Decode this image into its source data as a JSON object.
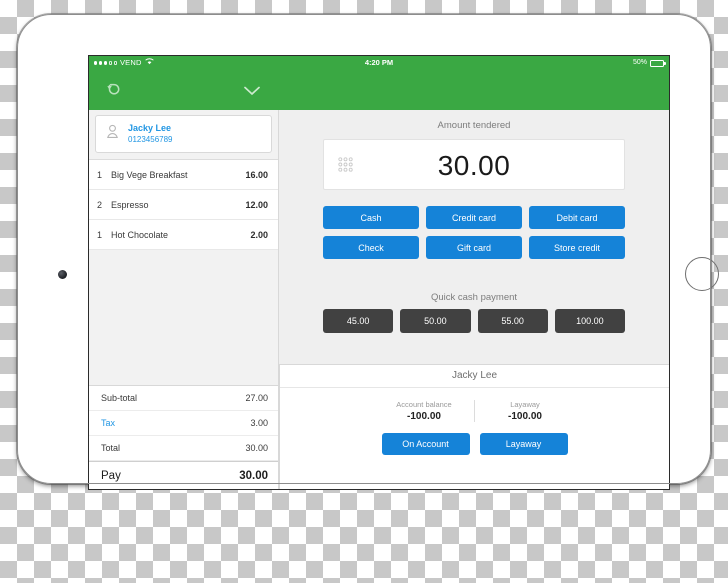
{
  "device": {
    "name": "tablet-device",
    "camera": "front-camera",
    "home_button": "home-button"
  },
  "status_bar": {
    "carrier": "VEND",
    "signal_filled": 3,
    "signal_total": 5,
    "wifi_icon": "wifi-icon",
    "time": "4:20 PM",
    "battery_percent": "50%",
    "battery_level": 50
  },
  "nav_bar": {
    "back_icon": "back-arrow-icon",
    "chevron_icon": "chevron-down-icon",
    "color": "#3aa843"
  },
  "sale": {
    "customer": {
      "name": "Jacky Lee",
      "phone": "0123456789",
      "icon": "person-icon"
    },
    "line_items": [
      {
        "qty": "1",
        "name": "Big Vege Breakfast",
        "price": "16.00"
      },
      {
        "qty": "2",
        "name": "Espresso",
        "price": "12.00"
      },
      {
        "qty": "1",
        "name": "Hot Chocolate",
        "price": "2.00"
      }
    ],
    "totals": [
      {
        "label": "Sub-total",
        "value": "27.00"
      },
      {
        "label": "Tax",
        "value": "3.00"
      },
      {
        "label": "Total",
        "value": "30.00"
      }
    ],
    "pay": {
      "label": "Pay",
      "value": "30.00"
    }
  },
  "payment": {
    "amount_label": "Amount tendered",
    "amount_value": "30.00",
    "keypad_icon": "keypad-grid-icon",
    "methods": [
      "Cash",
      "Credit card",
      "Debit card",
      "Check",
      "Gift card",
      "Store credit"
    ],
    "quick_cash_label": "Quick cash payment",
    "quick_cash": [
      "45.00",
      "50.00",
      "55.00",
      "100.00"
    ]
  },
  "customer_panel": {
    "title": "Jacky Lee",
    "stats": [
      {
        "label": "Account balance",
        "value": "-100.00"
      },
      {
        "label": "Layaway",
        "value": "-100.00"
      }
    ],
    "buttons": [
      "On Account",
      "Layaway"
    ]
  },
  "colors": {
    "brand_green": "#3aa843",
    "action_blue": "#1583d8",
    "quick_cash_dark": "#414141",
    "link_blue": "#2196e3"
  }
}
